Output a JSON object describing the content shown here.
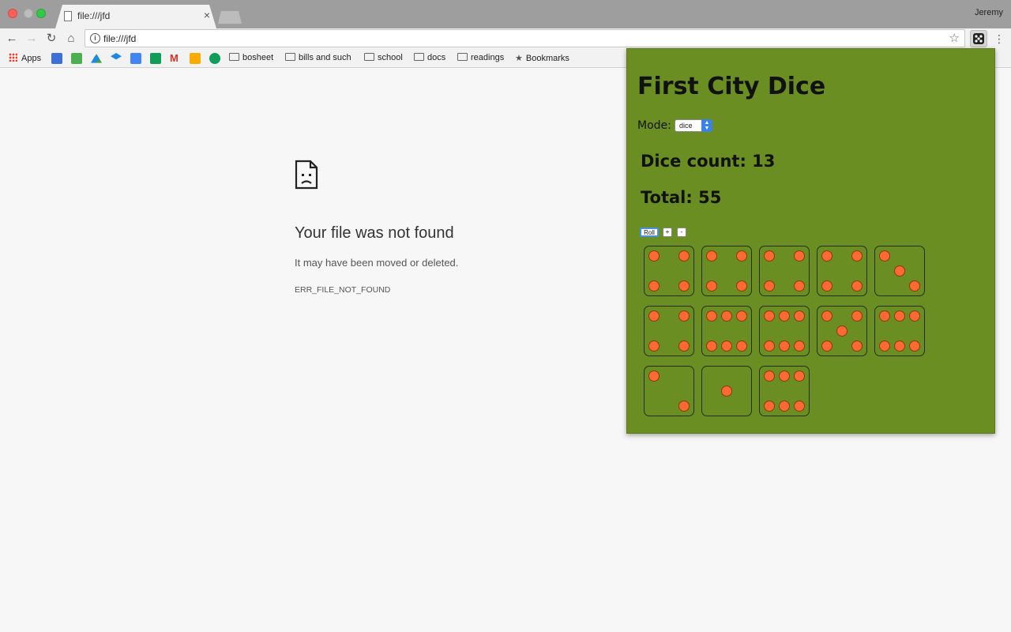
{
  "browser": {
    "tab_title": "file:///jfd",
    "tab_close": "×",
    "user": "Jeremy",
    "url": "file:///jfd",
    "bookmarks": {
      "apps": "Apps",
      "folders": [
        "bosheet",
        "bills and such",
        "school",
        "docs",
        "readings"
      ],
      "bookmarks_label": "Bookmarks"
    }
  },
  "error_page": {
    "title": "Your file was not found",
    "description": "It may have been moved or deleted.",
    "code": "ERR_FILE_NOT_FOUND"
  },
  "popup": {
    "title": "First City Dice",
    "mode_label": "Mode:",
    "mode_value": "dice",
    "dice_count": "Dice count: 13",
    "total": "Total: 55",
    "roll_label": "Roll",
    "plus_label": "+",
    "minus_label": "-",
    "dice": [
      4,
      4,
      4,
      4,
      3,
      4,
      6,
      6,
      5,
      6,
      2,
      1,
      6
    ],
    "pip_color": "#ff6a33",
    "background_color": "#6b8e23"
  }
}
